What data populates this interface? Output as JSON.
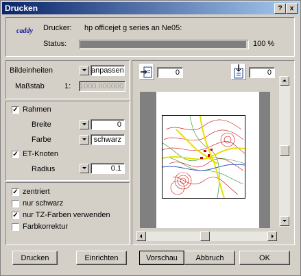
{
  "window": {
    "title": "Drucken",
    "help_label": "?",
    "close_label": "x"
  },
  "printer": {
    "logo": "caddy",
    "printer_label": "Drucker:",
    "printer_name": "hp officejet g series an Ne05:",
    "status_label": "Status:",
    "status_progress": 1.0,
    "status_text": "100 %"
  },
  "image": {
    "units_label": "Bildeinheiten",
    "units_value": "anpassen",
    "scale_label": "Maßstab",
    "scale_prefix": "1:",
    "scale_value": "1000.000000"
  },
  "frame": {
    "frame_label": "Rahmen",
    "frame_checked": true,
    "width_label": "Breite",
    "width_value": "0",
    "color_label": "Farbe",
    "color_value": "schwarz",
    "et_label": "ET-Knoten",
    "et_checked": true,
    "radius_label": "Radius",
    "radius_value": "0.1"
  },
  "options": [
    {
      "label": "zentriert",
      "checked": true
    },
    {
      "label": "nur schwarz",
      "checked": false
    },
    {
      "label": "nur TZ-Farben verwenden",
      "checked": true
    },
    {
      "label": "Farbkorrektur",
      "checked": false
    }
  ],
  "preview": {
    "offset_x_value": "0",
    "offset_y_value": "0"
  },
  "buttons": {
    "print": "Drucken",
    "setup": "Einrichten",
    "preview": "Vorschau",
    "cancel": "Abbruch",
    "ok": "OK"
  },
  "colors": {
    "title_start": "#0a246a",
    "title_end": "#a6caf0",
    "face": "#d4d0c8",
    "map_red": "#cc0000",
    "map_yellow": "#e8e000",
    "map_green": "#1a8a1a"
  }
}
